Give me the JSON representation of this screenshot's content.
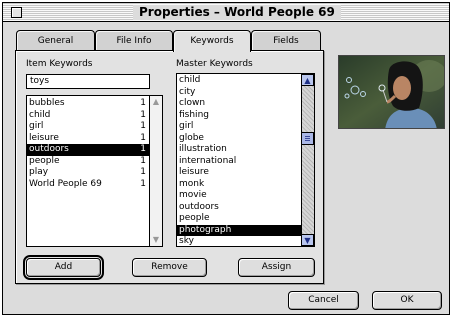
{
  "window": {
    "title": "Properties –  World People 69"
  },
  "tabs": [
    {
      "label": "General",
      "active": false
    },
    {
      "label": "File Info",
      "active": false
    },
    {
      "label": "Keywords",
      "active": true
    },
    {
      "label": "Fields",
      "active": false
    }
  ],
  "item_keywords": {
    "label": "Item Keywords",
    "input_value": "toys",
    "rows": [
      {
        "name": "bubbles",
        "count": "1",
        "selected": false
      },
      {
        "name": "child",
        "count": "1",
        "selected": false
      },
      {
        "name": "girl",
        "count": "1",
        "selected": false
      },
      {
        "name": "leisure",
        "count": "1",
        "selected": false
      },
      {
        "name": "outdoors",
        "count": "1",
        "selected": true
      },
      {
        "name": "people",
        "count": "1",
        "selected": false
      },
      {
        "name": "play",
        "count": "1",
        "selected": false
      },
      {
        "name": "World People 69",
        "count": "1",
        "selected": false
      }
    ]
  },
  "master_keywords": {
    "label": "Master Keywords",
    "rows": [
      {
        "name": "child",
        "selected": false
      },
      {
        "name": "city",
        "selected": false
      },
      {
        "name": "clown",
        "selected": false
      },
      {
        "name": "fishing",
        "selected": false
      },
      {
        "name": "girl",
        "selected": false
      },
      {
        "name": "globe",
        "selected": false
      },
      {
        "name": "illustration",
        "selected": false
      },
      {
        "name": "international",
        "selected": false
      },
      {
        "name": "leisure",
        "selected": false
      },
      {
        "name": "monk",
        "selected": false
      },
      {
        "name": "movie",
        "selected": false
      },
      {
        "name": "outdoors",
        "selected": false
      },
      {
        "name": "people",
        "selected": false
      },
      {
        "name": "photograph",
        "selected": true
      },
      {
        "name": "sky",
        "selected": false
      }
    ]
  },
  "buttons": {
    "add": "Add",
    "remove": "Remove",
    "assign": "Assign",
    "cancel": "Cancel",
    "ok": "OK"
  },
  "icons": {
    "scroll_up": "up-arrow-icon",
    "scroll_down": "down-arrow-icon",
    "close": "close-box-icon"
  },
  "colors": {
    "selection": "#000000",
    "scroll_arrow": "#b9c6ee",
    "window_bg": "#dcdcdc"
  }
}
